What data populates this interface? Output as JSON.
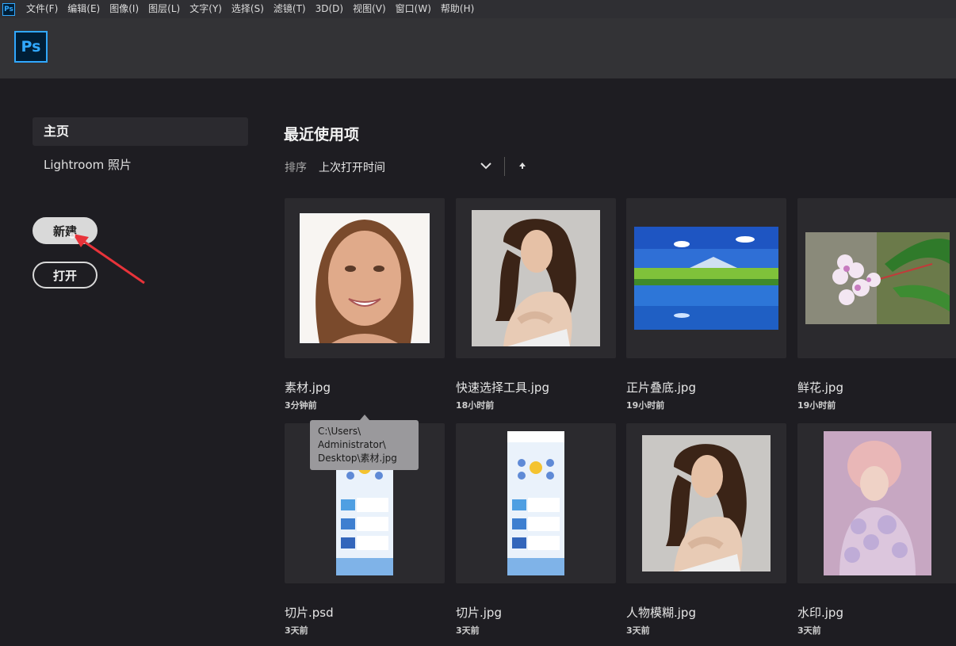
{
  "menubar": {
    "app_icon": "Ps",
    "items": [
      "文件(F)",
      "编辑(E)",
      "图像(I)",
      "图层(L)",
      "文字(Y)",
      "选择(S)",
      "滤镜(T)",
      "3D(D)",
      "视图(V)",
      "窗口(W)",
      "帮助(H)"
    ]
  },
  "header": {
    "logo": "Ps"
  },
  "sidebar": {
    "home_label": "主页",
    "lightroom_label": "Lightroom 照片",
    "new_button": "新建",
    "open_button": "打开"
  },
  "main": {
    "title": "最近使用项",
    "sort_label": "排序",
    "sort_value": "上次打开时间"
  },
  "recent_files": [
    {
      "name": "素材.jpg",
      "time": "3分钟前",
      "thumb": "portrait-smile"
    },
    {
      "name": "快速选择工具.jpg",
      "time": "18小时前",
      "thumb": "woman-curly"
    },
    {
      "name": "正片叠底.jpg",
      "time": "19小时前",
      "thumb": "lake-landscape"
    },
    {
      "name": "鲜花.jpg",
      "time": "19小时前",
      "thumb": "flowers"
    },
    {
      "name": "切片.psd",
      "time": "3天前",
      "thumb": "infographic"
    },
    {
      "name": "切片.jpg",
      "time": "3天前",
      "thumb": "infographic"
    },
    {
      "name": "人物模糊.jpg",
      "time": "3天前",
      "thumb": "woman-curly"
    },
    {
      "name": "水印.jpg",
      "time": "3天前",
      "thumb": "pastel-portrait"
    }
  ],
  "tooltip": {
    "lines": [
      "C:\\Users\\",
      "Administrator\\",
      "Desktop\\素材.jpg"
    ]
  },
  "colors": {
    "ps_blue": "#31a8ff",
    "annotation_red": "#e8333a"
  }
}
